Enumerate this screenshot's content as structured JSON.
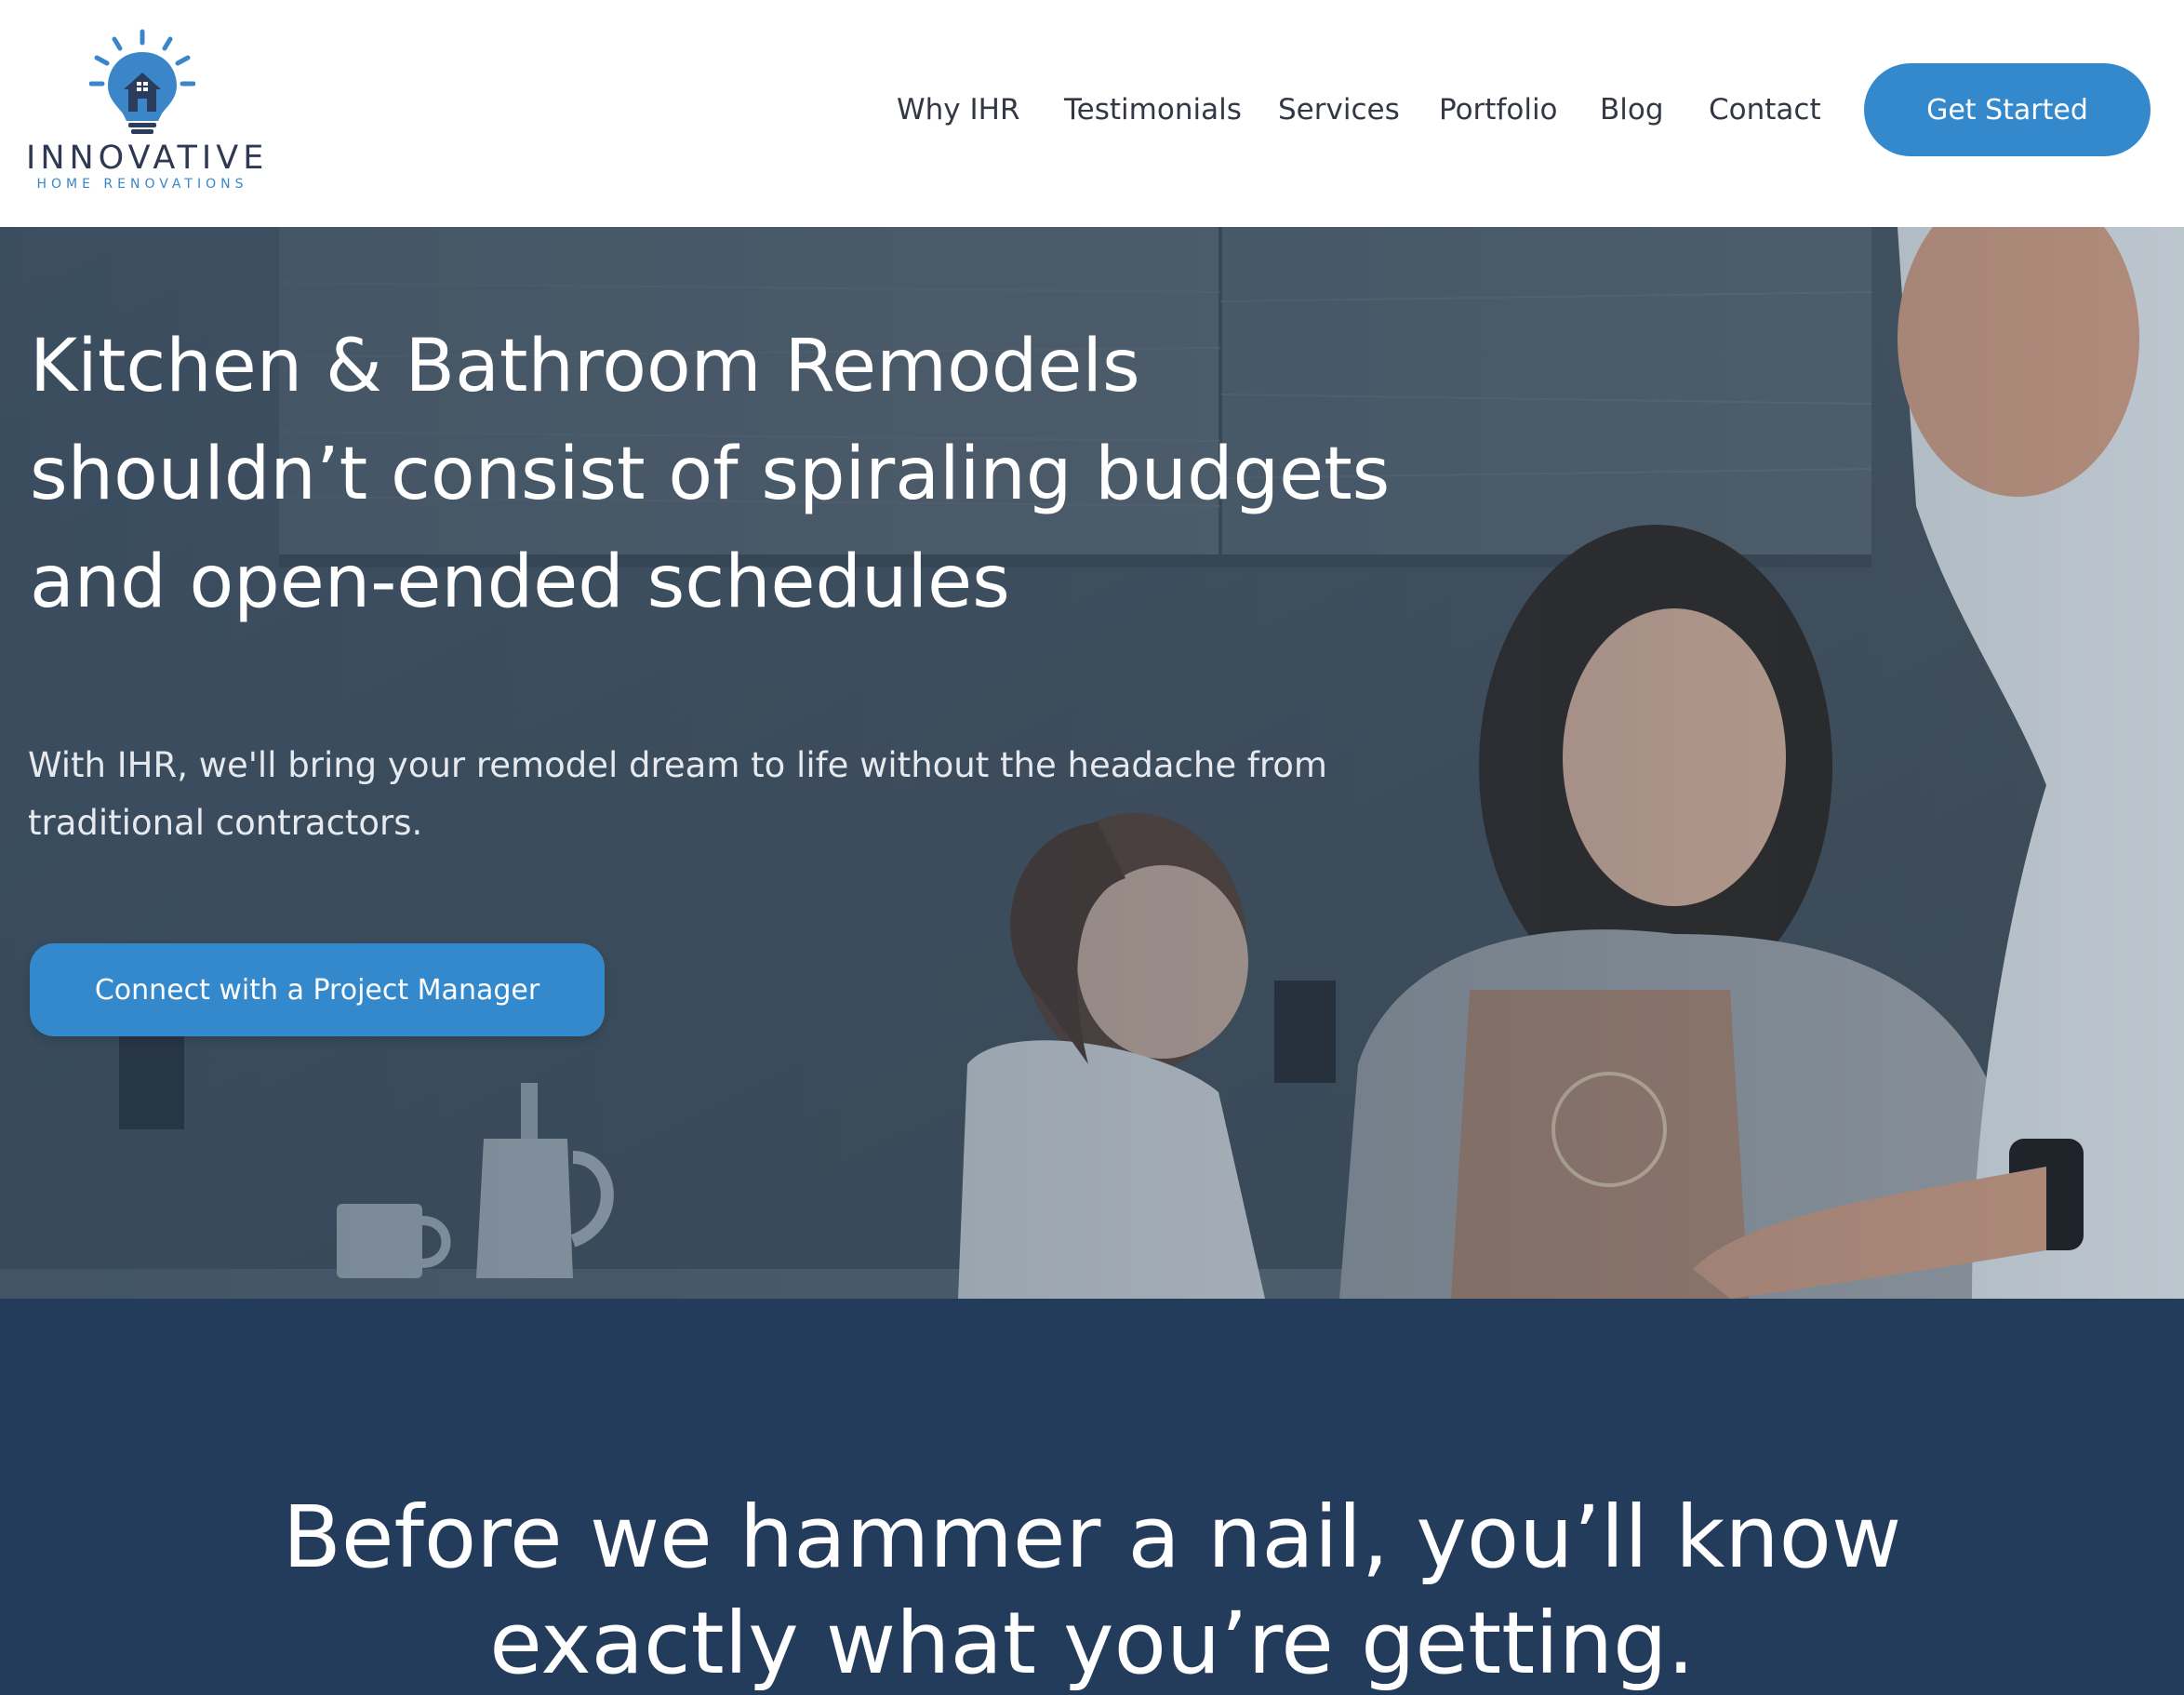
{
  "brand": {
    "name": "INNOVATIVE",
    "tagline": "HOME RENOVATIONS",
    "accent_color": "#3488cc",
    "dark_color": "#243c5c",
    "logo_icon": "lightbulb-house-icon"
  },
  "nav": {
    "items": [
      {
        "label": "Why IHR"
      },
      {
        "label": "Testimonials"
      },
      {
        "label": "Services"
      },
      {
        "label": "Portfolio"
      },
      {
        "label": "Blog"
      },
      {
        "label": "Contact"
      }
    ],
    "cta_label": "Get Started"
  },
  "hero": {
    "title_lines": [
      "Kitchen & Bathroom Remodels",
      "shouldn’t consist of spiraling budgets",
      "and open-ended schedules"
    ],
    "subtitle": "With IHR, we'll bring your remodel dream to life without the headache from traditional contractors.",
    "cta_label": "Connect with a Project Manager"
  },
  "value": {
    "heading_lines": [
      "Before we hammer a nail, you’ll know",
      "exactly what you’re getting."
    ]
  }
}
